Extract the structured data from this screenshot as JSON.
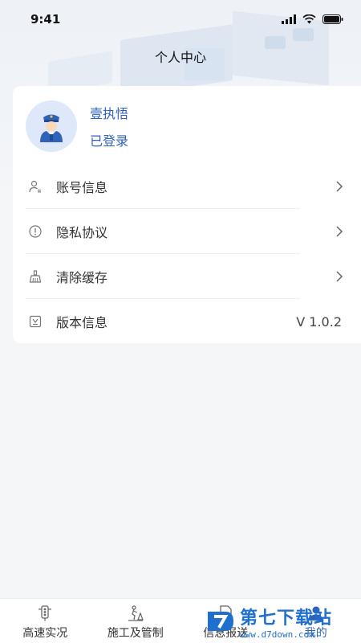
{
  "status_bar": {
    "time": "9:41"
  },
  "header": {
    "title": "个人中心"
  },
  "profile": {
    "name": "壹执悟",
    "status": "已登录"
  },
  "menu": [
    {
      "label": "账号信息",
      "icon": "user-icon"
    },
    {
      "label": "隐私协议",
      "icon": "info-icon"
    },
    {
      "label": "清除缓存",
      "icon": "broom-icon"
    },
    {
      "label": "版本信息",
      "icon": "version-icon",
      "value": "V 1.0.2"
    }
  ],
  "tabs": [
    {
      "label": "高速实况",
      "icon": "traffic-light-icon"
    },
    {
      "label": "施工及管制",
      "icon": "construction-icon"
    },
    {
      "label": "信息报送",
      "icon": "report-icon"
    },
    {
      "label": "我的",
      "icon": "profile-icon",
      "active": true
    }
  ],
  "watermark": {
    "title": "第七下载站",
    "url": "www.d7down.com"
  },
  "colors": {
    "accent": "#2f62b8",
    "background": "#f5f6f8",
    "card": "#ffffff"
  }
}
